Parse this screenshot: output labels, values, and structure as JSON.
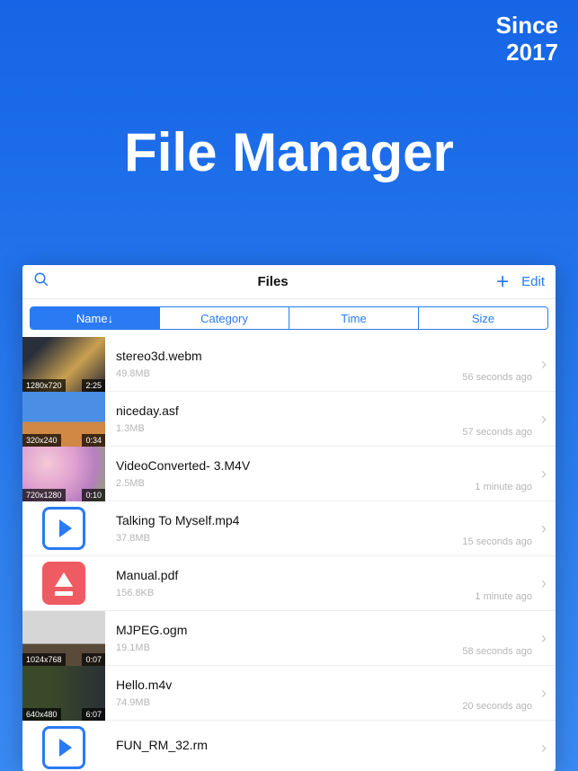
{
  "banner": {
    "since_line1": "Since",
    "since_line2": "2017",
    "title": "File Manager"
  },
  "nav": {
    "title": "Files",
    "edit": "Edit"
  },
  "segments": [
    "Name↓",
    "Category",
    "Time",
    "Size"
  ],
  "active_segment": 0,
  "files": [
    {
      "name": "stereo3d.webm",
      "size": "49.8MB",
      "time": "56 seconds ago",
      "res": "1280x720",
      "dur": "2:25",
      "thumb": "video1"
    },
    {
      "name": "niceday.asf",
      "size": "1.3MB",
      "time": "57 seconds ago",
      "res": "320x240",
      "dur": "0:34",
      "thumb": "video2"
    },
    {
      "name": "VideoConverted- 3.M4V",
      "size": "2.5MB",
      "time": "1 minute ago",
      "res": "720x1280",
      "dur": "0:10",
      "thumb": "video3"
    },
    {
      "name": "Talking To Myself.mp4",
      "size": "37.8MB",
      "time": "15 seconds ago",
      "thumb": "play"
    },
    {
      "name": "Manual.pdf",
      "size": "156.8KB",
      "time": "1 minute ago",
      "thumb": "pdf"
    },
    {
      "name": "MJPEG.ogm",
      "size": "19.1MB",
      "time": "58 seconds ago",
      "res": "1024x768",
      "dur": "0:07",
      "thumb": "video6"
    },
    {
      "name": "Hello.m4v",
      "size": "74.9MB",
      "time": "20 seconds ago",
      "res": "640x480",
      "dur": "6:07",
      "thumb": "video7"
    },
    {
      "name": "FUN_RM_32.rm",
      "size": "",
      "time": "",
      "thumb": "play"
    }
  ]
}
